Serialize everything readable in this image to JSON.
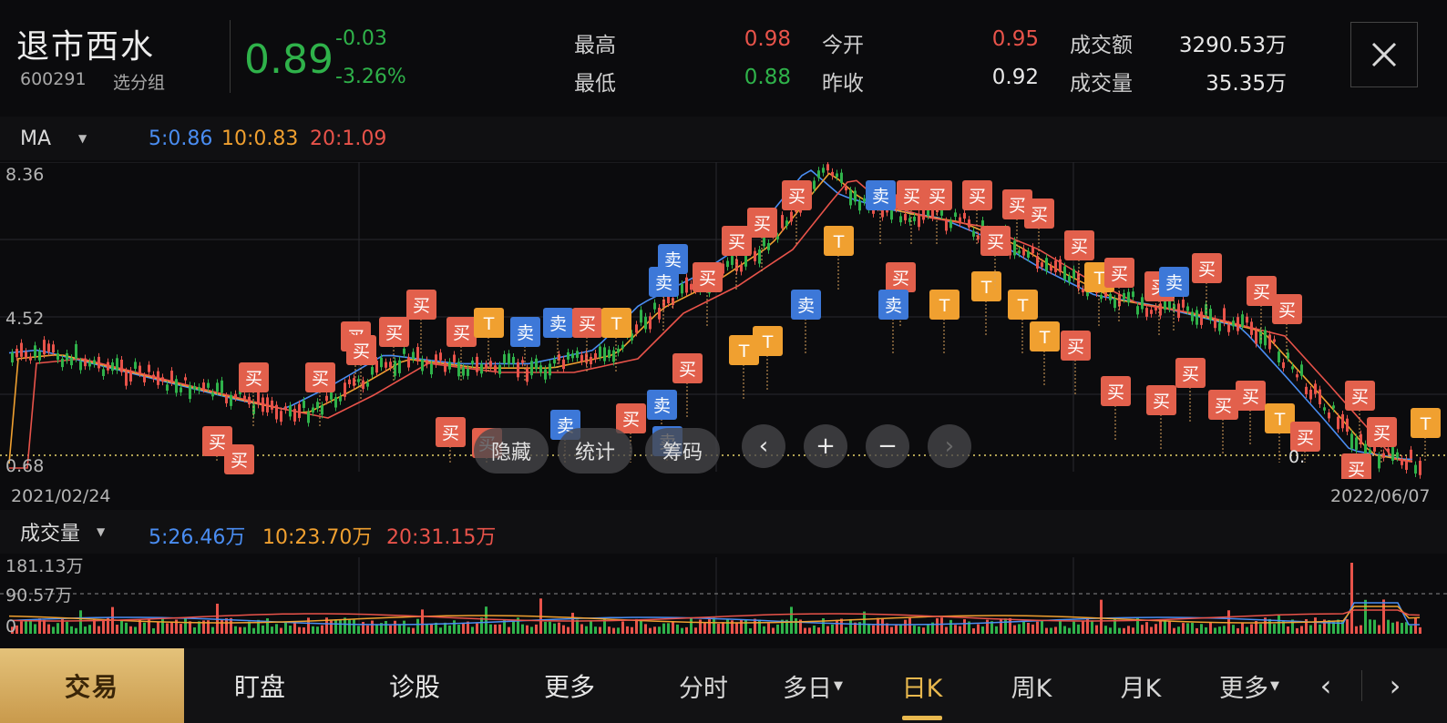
{
  "stock": {
    "name": "退市西水",
    "code": "600291",
    "group": "选分组",
    "price": "0.89",
    "change": "-0.03",
    "change_pct": "-3.26%"
  },
  "quote": {
    "high_label": "最高",
    "high": "0.98",
    "low_label": "最低",
    "low": "0.88",
    "open_label": "今开",
    "open": "0.95",
    "prev_label": "昨收",
    "prev": "0.92",
    "amount_label": "成交额",
    "amount": "3290.53万",
    "volume_label": "成交量",
    "volume": "35.35万"
  },
  "ma_bar": {
    "selector": "MA",
    "ma5": "5:0.86",
    "ma10": "10:0.83",
    "ma20": "20:1.09"
  },
  "kline": {
    "y_top": "8.36",
    "y_mid": "4.52",
    "y_bottom": "0.68",
    "last_tag": "0.",
    "date_start": "2021/02/24",
    "date_end": "2022/06/07"
  },
  "signals": {
    "buy": "买",
    "sell": "卖",
    "t": "T"
  },
  "controls": {
    "hide": "隐藏",
    "stats": "统计",
    "chips": "筹码",
    "prev": "‹",
    "zoom_in": "+",
    "zoom_out": "−",
    "next": "›"
  },
  "vol_bar": {
    "selector": "成交量",
    "ma5": "5:26.46万",
    "ma10": "10:23.70万",
    "ma20": "20:31.15万",
    "y_top": "181.13万",
    "y_mid": "90.57万",
    "y_zero": "0"
  },
  "bottom_nav": {
    "trade": "交易",
    "watch": "盯盘",
    "diagnose": "诊股",
    "more": "更多"
  },
  "period_tabs": {
    "intraday": "分时",
    "multi_day": "多日",
    "day_k": "日K",
    "week_k": "周K",
    "month_k": "月K",
    "more": "更多",
    "active": "日K"
  },
  "colors": {
    "up": "#e8534a",
    "down": "#2fb24a",
    "ma5": "#4a8df2",
    "ma10": "#f0a030",
    "ma20": "#e8534a",
    "accent": "#e8b84e"
  }
}
